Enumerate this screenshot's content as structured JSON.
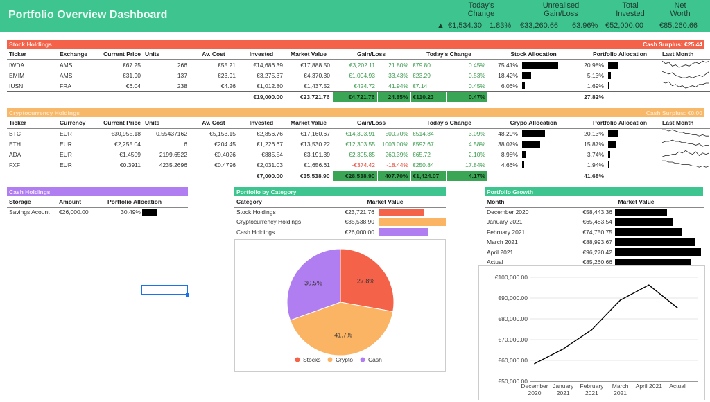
{
  "header": {
    "title": "Portfolio Overview Dashboard",
    "kpis": {
      "todays_change_label": "Today's Change",
      "unrealised_label": "Unrealised Gain/Loss",
      "invested_label": "Total Invested",
      "net_worth_label": "Net Worth",
      "arrow": "▲",
      "todays_change": "€1,534.30",
      "todays_change_pct": "1.83%",
      "unrealised": "€33,260.66",
      "unrealised_pct": "63.96%",
      "invested": "€52,000.00",
      "net_worth": "€85,260.66"
    }
  },
  "colors": {
    "header": "#3ec48f",
    "stocks": "#f4624a",
    "crypto": "#f8b869",
    "cash": "#b07ef0",
    "gain": "#3d9c4f",
    "loss": "#e04a3a"
  },
  "stocks": {
    "title": "Stock Holdings",
    "surplus": "Cash Surplus:  €25.44",
    "columns": [
      "Ticker",
      "Exchange",
      "Current Price",
      "Units",
      "Av. Cost",
      "Invested",
      "Market Value",
      "Gain/Loss",
      "Today's Change",
      "Stock Allocation",
      "Portfolio Allocation",
      "Last Month"
    ],
    "rows": [
      {
        "ticker": "IWDA",
        "exchange": "AMS",
        "price": "€67.25",
        "units": "266",
        "avcost": "€55.21",
        "invested": "€14,686.39",
        "value": "€17,888.50",
        "gain": "€3,202.11",
        "gain_pct": "21.80%",
        "today": "€79.80",
        "today_pct": "0.45%",
        "alloc": "75.41%",
        "alloc_v": 75.41,
        "palloc": "20.98%",
        "palloc_v": 20.98,
        "spark": [
          6,
          4,
          5,
          2,
          3,
          1,
          2,
          3,
          2,
          4,
          5,
          4,
          6,
          5,
          6
        ]
      },
      {
        "ticker": "EMIM",
        "exchange": "AMS",
        "price": "€31.90",
        "units": "137",
        "avcost": "€23.91",
        "invested": "€3,275.37",
        "value": "€4,370.30",
        "gain": "€1,094.93",
        "gain_pct": "33.43%",
        "today": "€23.29",
        "today_pct": "0.53%",
        "alloc": "18.42%",
        "alloc_v": 18.42,
        "palloc": "5.13%",
        "palloc_v": 5.13,
        "spark": [
          6,
          5,
          4,
          5,
          3,
          2,
          1,
          1,
          2,
          1,
          2,
          3,
          2,
          4,
          6
        ]
      },
      {
        "ticker": "IUSN",
        "exchange": "FRA",
        "price": "€6.04",
        "units": "238",
        "avcost": "€4.26",
        "invested": "€1,012.80",
        "value": "€1,437.52",
        "gain": "€424.72",
        "gain_pct": "41.94%",
        "today": "€7.14",
        "today_pct": "0.45%",
        "alloc": "6.06%",
        "alloc_v": 6.06,
        "palloc": "1.69%",
        "palloc_v": 1.69,
        "spark": [
          6,
          5,
          6,
          3,
          4,
          2,
          3,
          1,
          2,
          3,
          2,
          4,
          4,
          5,
          5
        ]
      }
    ],
    "totals": {
      "invested": "€19,000.00",
      "value": "€23,721.76",
      "gain": "€4,721.76",
      "gain_pct": "24.85%",
      "today": "€110.23",
      "today_pct": "0.47%",
      "palloc": "27.82%"
    }
  },
  "crypto": {
    "title": "Cryptocurrency Holdings",
    "surplus": "Cash Surplus:  €0.00",
    "columns": [
      "Ticker",
      "Currency",
      "Current Price",
      "Units",
      "Av. Cost",
      "Invested",
      "Market Value",
      "Gain/Loss",
      "Today's Change",
      "Crypo Allocation",
      "Portfolio Allocation",
      "Last Month"
    ],
    "rows": [
      {
        "ticker": "BTC",
        "exchange": "EUR",
        "price": "€30,955.18",
        "units": "0.55437162",
        "avcost": "€5,153.15",
        "invested": "€2,856.76",
        "value": "€17,160.67",
        "gain": "€14,303.91",
        "gain_pct": "500.70%",
        "today": "€514.84",
        "today_pct": "3.09%",
        "alloc": "48.29%",
        "alloc_v": 48.29,
        "palloc": "20.13%",
        "palloc_v": 20.13,
        "spark": [
          6,
          6,
          5,
          6,
          5,
          4,
          4,
          3,
          3,
          2,
          2,
          1,
          2,
          1,
          1
        ]
      },
      {
        "ticker": "ETH",
        "exchange": "EUR",
        "price": "€2,255.04",
        "units": "6",
        "avcost": "€204.45",
        "invested": "€1,226.67",
        "value": "€13,530.22",
        "gain": "€12,303.55",
        "gain_pct": "1003.00%",
        "today": "€592.67",
        "today_pct": "4.58%",
        "alloc": "38.07%",
        "alloc_v": 38.07,
        "palloc": "15.87%",
        "palloc_v": 15.87,
        "spark": [
          4,
          5,
          5,
          6,
          5,
          5,
          4,
          4,
          3,
          3,
          2,
          3,
          1,
          2,
          2
        ]
      },
      {
        "ticker": "ADA",
        "exchange": "EUR",
        "price": "€1.4509",
        "units": "2199.6522",
        "avcost": "€0.4026",
        "invested": "€885.54",
        "value": "€3,191.39",
        "gain": "€2,305.85",
        "gain_pct": "260.39%",
        "today": "€65.72",
        "today_pct": "2.10%",
        "alloc": "8.98%",
        "alloc_v": 8.98,
        "palloc": "3.74%",
        "palloc_v": 3.74,
        "spark": [
          1,
          2,
          2,
          3,
          3,
          5,
          4,
          6,
          4,
          3,
          5,
          2,
          4,
          3,
          4
        ]
      },
      {
        "ticker": "FXF",
        "exchange": "EUR",
        "price": "€0.3911",
        "units": "4235.2696",
        "avcost": "€0.4796",
        "invested": "€2,031.03",
        "value": "€1,656.61",
        "gain": "-€374.42",
        "gain_pct": "-18.44%",
        "today": "€250.84",
        "today_pct": "17.84%",
        "alloc": "4.66%",
        "alloc_v": 4.66,
        "palloc": "1.94%",
        "palloc_v": 1.94,
        "spark": [
          6,
          6,
          5,
          5,
          4,
          4,
          3,
          3,
          3,
          2,
          2,
          1,
          2,
          1,
          2
        ],
        "loss": true
      }
    ],
    "totals": {
      "invested": "€7,000.00",
      "value": "€35,538.90",
      "gain": "€28,538.90",
      "gain_pct": "407.70%",
      "today": "€1,424.07",
      "today_pct": "4.17%",
      "palloc": "41.68%"
    }
  },
  "cash": {
    "title": "Cash Holdings",
    "columns": [
      "Storage",
      "Amount",
      "Portfolio Allocation"
    ],
    "rows": [
      {
        "storage": "Savings Acount",
        "amount": "€26,000.00",
        "palloc": "30.49%",
        "palloc_v": 30.49
      }
    ]
  },
  "category": {
    "title": "Portfolio by Category",
    "columns": [
      "Category",
      "Market Value"
    ],
    "rows": [
      {
        "name": "Stock Holdings",
        "value": "€23,721.76",
        "v": 23721.76,
        "color": "#f4624a"
      },
      {
        "name": "Cryptocurrency Holdings",
        "value": "€35,538.90",
        "v": 35538.9,
        "color": "#fbb464"
      },
      {
        "name": "Cash Holdings",
        "value": "€26,000.00",
        "v": 26000,
        "color": "#b07ef0"
      }
    ]
  },
  "chart_data": [
    {
      "type": "pie",
      "slices": [
        {
          "name": "Stocks",
          "value": 27.8,
          "label": "27.8%",
          "color": "#f4624a"
        },
        {
          "name": "Crypto",
          "value": 41.7,
          "label": "41.7%",
          "color": "#fbb464"
        },
        {
          "name": "Cash",
          "value": 30.5,
          "label": "30.5%",
          "color": "#b07ef0"
        }
      ],
      "legend": "bottom"
    },
    {
      "type": "line",
      "categories": [
        "December 2020",
        "January 2021",
        "February 2021",
        "March 2021",
        "April 2021",
        "Actual"
      ],
      "x_tick_labels": [
        [
          "December",
          "2020"
        ],
        [
          "January",
          "2021"
        ],
        [
          "February",
          "2021"
        ],
        [
          "March",
          "2021"
        ],
        [
          "April 2021",
          ""
        ],
        [
          "Actual",
          ""
        ]
      ],
      "values": [
        58443.36,
        65483.54,
        74750.75,
        88993.67,
        96270.42,
        85260.66
      ],
      "ylim": [
        50000,
        100000
      ],
      "y_ticks": [
        "€50,000.00",
        "€60,000.00",
        "€70,000.00",
        "€80,000.00",
        "€90,000.00",
        "€100,000.00"
      ],
      "grid": true,
      "color": "#000000"
    }
  ],
  "growth": {
    "title": "Portfolio Growth",
    "columns": [
      "Month",
      "Market Value"
    ],
    "rows": [
      {
        "month": "December 2020",
        "value": "€58,443.36",
        "v": 58443.36
      },
      {
        "month": "January 2021",
        "value": "€65,483.54",
        "v": 65483.54
      },
      {
        "month": "February 2021",
        "value": "€74,750.75",
        "v": 74750.75
      },
      {
        "month": "March 2021",
        "value": "€88,993.67",
        "v": 88993.67
      },
      {
        "month": "April 2021",
        "value": "€96,270.42",
        "v": 96270.42
      },
      {
        "month": "Actual",
        "value": "€85,260.66",
        "v": 85260.66
      }
    ]
  }
}
